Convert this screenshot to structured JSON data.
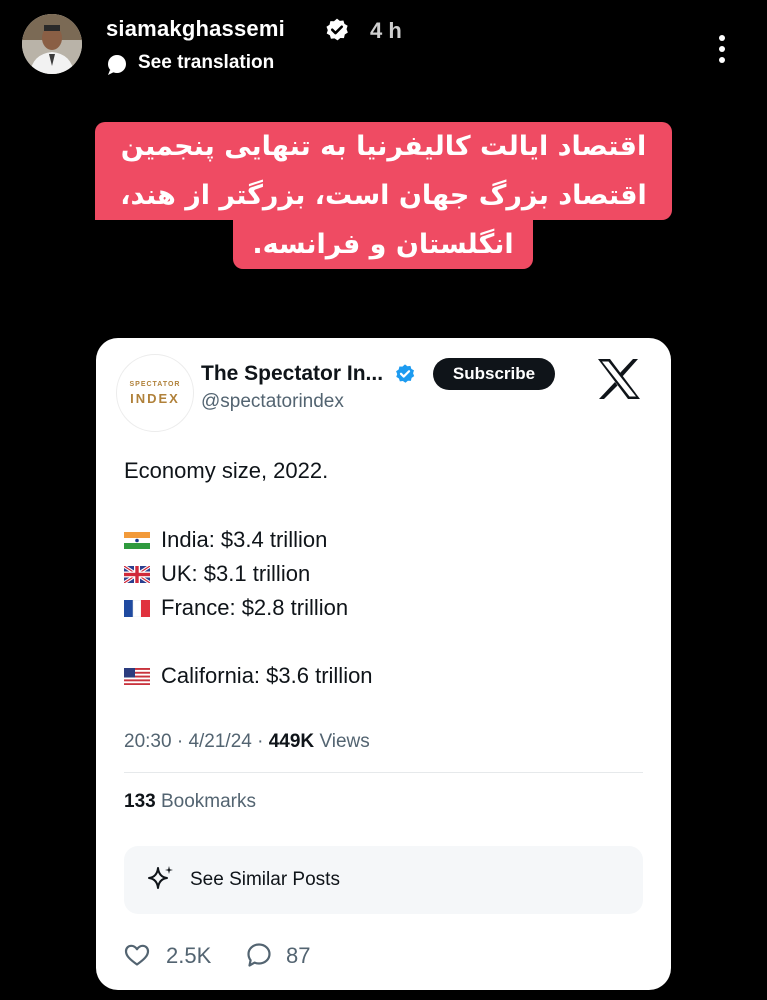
{
  "story": {
    "username": "siamakghassemi",
    "time_ago": "4 h",
    "see_translation": "See translation",
    "caption_lines": [
      "اقتصاد ایالت کالیفرنیا به تنهایی پنجمین",
      "اقتصاد بزرگ جهان است، بزرگتر از هند،",
      "انگلستان و فرانسه."
    ],
    "caption_bg_color": "#ef4b63"
  },
  "tweet": {
    "avatar_logo_top": "SPECTATOR",
    "avatar_logo_bottom": "INDEX",
    "display_name": "The Spectator In...",
    "handle": "@spectatorindex",
    "subscribe_label": "Subscribe",
    "body_heading": "Economy size, 2022.",
    "items": [
      {
        "flag": "india-flag",
        "text": "India: $3.4 trillion"
      },
      {
        "flag": "uk-flag",
        "text": "UK: $3.1 trillion"
      },
      {
        "flag": "france-flag",
        "text": "France: $2.8 trillion"
      },
      {
        "flag": "us-flag",
        "text": "California: $3.6 trillion"
      }
    ],
    "time": "20:30",
    "date": "4/21/24",
    "views_count": "449K",
    "views_label": "Views",
    "bookmarks_count": "133",
    "bookmarks_label": "Bookmarks",
    "similar_posts_label": "See Similar Posts",
    "likes": "2.5K",
    "replies": "87"
  },
  "icons": [
    "verified-icon",
    "translate-icon",
    "more-icon",
    "x-logo-icon",
    "sparkle-icon",
    "heart-icon",
    "reply-icon"
  ],
  "colors": {
    "background": "#000000",
    "card": "#ffffff",
    "caption": "#ef4b63",
    "twitter_blue": "#1d9bf0",
    "secondary_text": "#536471"
  }
}
